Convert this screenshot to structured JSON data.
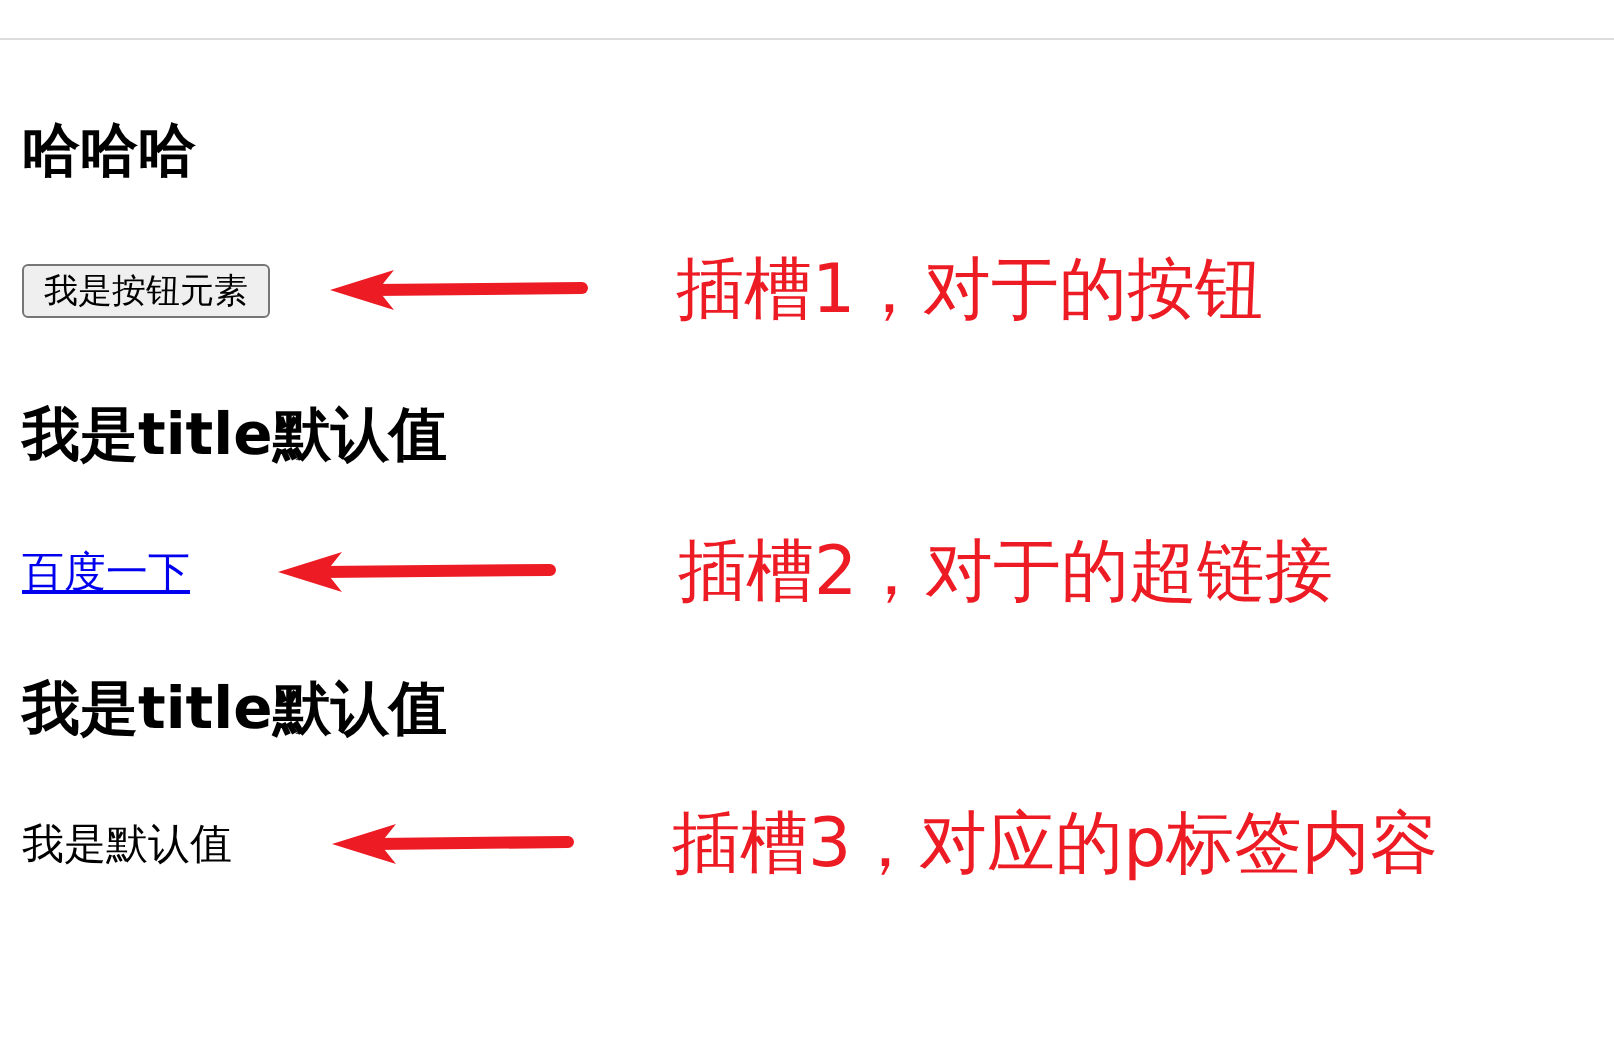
{
  "page": [
    {
      "kind": "heading1",
      "text": "哈哈哈"
    },
    {
      "kind": "button",
      "text": "我是按钮元素",
      "note": "插槽1，对于的按钮"
    },
    {
      "kind": "heading2",
      "text": "我是title默认值"
    },
    {
      "kind": "link",
      "text": "百度一下",
      "note": "插槽2，对于的超链接"
    },
    {
      "kind": "heading2",
      "text": "我是title默认值"
    },
    {
      "kind": "paragraph",
      "text": "我是默认值",
      "note": "插槽3，对应的p标签内容"
    }
  ]
}
